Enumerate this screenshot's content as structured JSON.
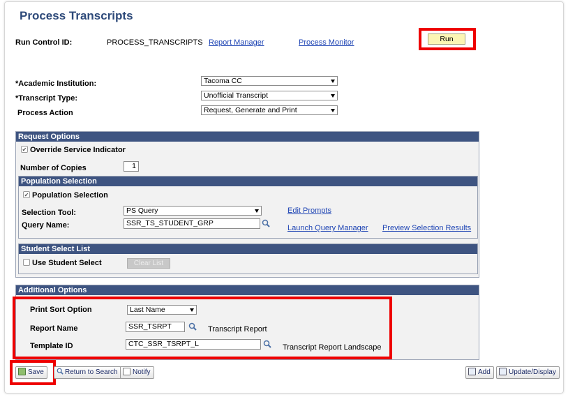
{
  "page": {
    "title": "Process Transcripts"
  },
  "header": {
    "run_control_label": "Run Control ID:",
    "run_control_value": "PROCESS_TRANSCRIPTS",
    "report_manager": "Report Manager",
    "process_monitor": "Process Monitor",
    "run": "Run"
  },
  "form": {
    "institution_label": "*Academic Institution:",
    "institution_value": "Tacoma CC",
    "transcript_type_label": "*Transcript Type:",
    "transcript_type_value": "Unofficial Transcript",
    "process_action_label": "Process Action",
    "process_action_value": "Request, Generate and Print"
  },
  "request_options": {
    "header": "Request Options",
    "override_label": "Override Service Indicator",
    "override_checked": true,
    "copies_label": "Number of Copies",
    "copies_value": "1"
  },
  "population_selection": {
    "header": "Population Selection",
    "checkbox_label": "Population Selection",
    "checkbox_checked": true,
    "tool_label": "Selection Tool:",
    "tool_value": "PS Query",
    "edit_prompts": "Edit Prompts",
    "query_label": "Query Name:",
    "query_value": "SSR_TS_STUDENT_GRP",
    "launch_query_manager": "Launch Query Manager",
    "preview_results": "Preview Selection Results"
  },
  "student_select": {
    "header": "Student Select List",
    "checkbox_label": "Use Student Select",
    "checkbox_checked": false,
    "clear_list": "Clear List"
  },
  "additional_options": {
    "header": "Additional Options",
    "sort_label": "Print Sort Option",
    "sort_value": "Last Name",
    "report_label": "Report Name",
    "report_value": "SSR_TSRPT",
    "report_desc": "Transcript Report",
    "template_label": "Template ID",
    "template_value": "CTC_SSR_TSRPT_L",
    "template_desc": "Transcript Report Landscape"
  },
  "toolbar": {
    "save": "Save",
    "return_to_search": "Return to Search",
    "notify": "Notify",
    "add": "Add",
    "update_display": "Update/Display"
  },
  "colors": {
    "panel_header": "#3e5481",
    "link": "#1f45b4",
    "title": "#2e4a7a",
    "highlight": "#ee0000",
    "run_button": "#fcf6b4"
  }
}
